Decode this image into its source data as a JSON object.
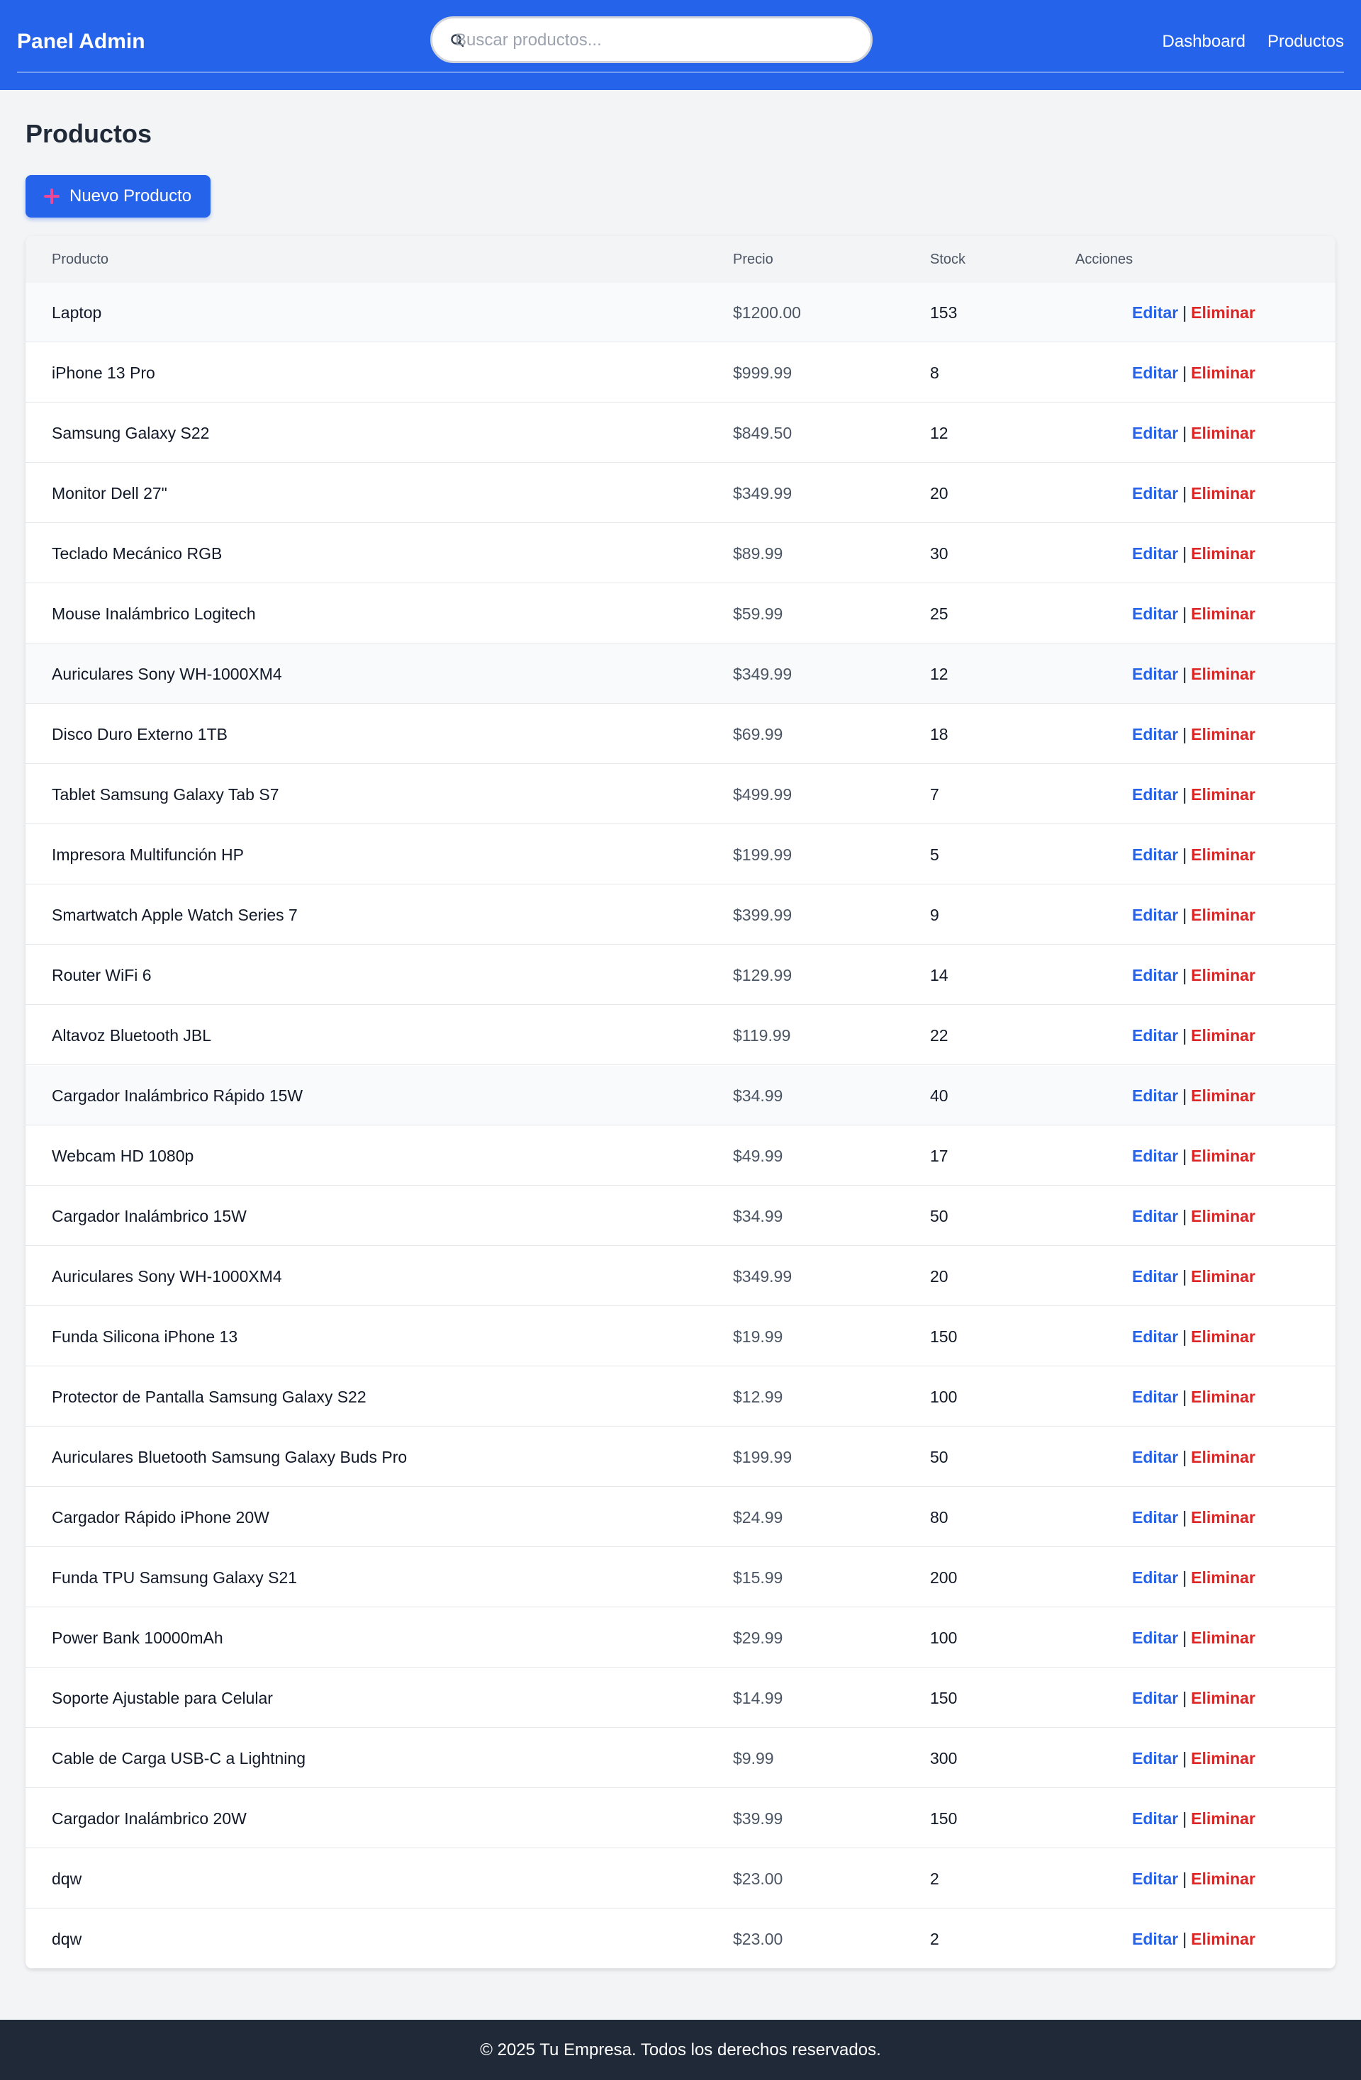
{
  "header": {
    "brand": "Panel Admin",
    "search_placeholder": "Buscar productos...",
    "nav": [
      "Dashboard",
      "Productos"
    ]
  },
  "main": {
    "title": "Productos",
    "new_button": "Nuevo Producto"
  },
  "table": {
    "columns": [
      "Producto",
      "Precio",
      "Stock",
      "Acciones"
    ],
    "edit_label": "Editar",
    "separator": "|",
    "delete_label": "Eliminar",
    "rows": [
      {
        "name": "Laptop",
        "price": "$1200.00",
        "stock": "153"
      },
      {
        "name": "iPhone 13 Pro",
        "price": "$999.99",
        "stock": "8"
      },
      {
        "name": "Samsung Galaxy S22",
        "price": "$849.50",
        "stock": "12"
      },
      {
        "name": "Monitor Dell 27\"",
        "price": "$349.99",
        "stock": "20"
      },
      {
        "name": "Teclado Mecánico RGB",
        "price": "$89.99",
        "stock": "30"
      },
      {
        "name": "Mouse Inalámbrico Logitech",
        "price": "$59.99",
        "stock": "25"
      },
      {
        "name": "Auriculares Sony WH-1000XM4",
        "price": "$349.99",
        "stock": "12"
      },
      {
        "name": "Disco Duro Externo 1TB",
        "price": "$69.99",
        "stock": "18"
      },
      {
        "name": "Tablet Samsung Galaxy Tab S7",
        "price": "$499.99",
        "stock": "7"
      },
      {
        "name": "Impresora Multifunción HP",
        "price": "$199.99",
        "stock": "5"
      },
      {
        "name": "Smartwatch Apple Watch Series 7",
        "price": "$399.99",
        "stock": "9"
      },
      {
        "name": "Router WiFi 6",
        "price": "$129.99",
        "stock": "14"
      },
      {
        "name": "Altavoz Bluetooth JBL",
        "price": "$119.99",
        "stock": "22"
      },
      {
        "name": "Cargador Inalámbrico Rápido 15W",
        "price": "$34.99",
        "stock": "40"
      },
      {
        "name": "Webcam HD 1080p",
        "price": "$49.99",
        "stock": "17"
      },
      {
        "name": "Cargador Inalámbrico 15W",
        "price": "$34.99",
        "stock": "50"
      },
      {
        "name": "Auriculares Sony WH-1000XM4",
        "price": "$349.99",
        "stock": "20"
      },
      {
        "name": "Funda Silicona iPhone 13",
        "price": "$19.99",
        "stock": "150"
      },
      {
        "name": "Protector de Pantalla Samsung Galaxy S22",
        "price": "$12.99",
        "stock": "100"
      },
      {
        "name": "Auriculares Bluetooth Samsung Galaxy Buds Pro",
        "price": "$199.99",
        "stock": "50"
      },
      {
        "name": "Cargador Rápido iPhone 20W",
        "price": "$24.99",
        "stock": "80"
      },
      {
        "name": "Funda TPU Samsung Galaxy S21",
        "price": "$15.99",
        "stock": "200"
      },
      {
        "name": "Power Bank 10000mAh",
        "price": "$29.99",
        "stock": "100"
      },
      {
        "name": "Soporte Ajustable para Celular",
        "price": "$14.99",
        "stock": "150"
      },
      {
        "name": "Cable de Carga USB-C a Lightning",
        "price": "$9.99",
        "stock": "300"
      },
      {
        "name": "Cargador Inalámbrico 20W",
        "price": "$39.99",
        "stock": "150"
      },
      {
        "name": "dqw",
        "price": "$23.00",
        "stock": "2"
      },
      {
        "name": "dqw",
        "price": "$23.00",
        "stock": "2"
      }
    ]
  },
  "footer": {
    "text": "© 2025 Tu Empresa. Todos los derechos reservados."
  },
  "colors": {
    "primary": "#2563eb",
    "danger": "#dc2626",
    "footer_bg": "#1f2937",
    "page_bg": "#f3f4f6"
  }
}
